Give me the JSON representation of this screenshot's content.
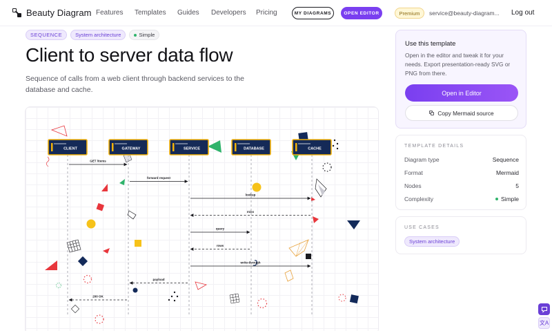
{
  "nav": {
    "brand": "Beauty Diagram",
    "links": [
      "Features",
      "Templates",
      "Guides",
      "Developers",
      "Pricing"
    ],
    "my_diagrams": "MY DIAGRAMS",
    "open_editor": "OPEN EDITOR",
    "premium": "Premium",
    "email": "service@beauty-diagram...",
    "logout": "Log out"
  },
  "hero": {
    "tags": {
      "type": "SEQUENCE",
      "category": "System architecture",
      "complexity": "Simple"
    },
    "title": "Client to server data flow",
    "subtitle": "Sequence of calls from a web client through backend services to the database and cache."
  },
  "diagram": {
    "participants": [
      "CLIENT",
      "GATEWAY",
      "SERVICE",
      "DATABASE",
      "CACHE"
    ],
    "messages": [
      {
        "from": 0,
        "to": 1,
        "label": "GET /items",
        "dashed": false
      },
      {
        "from": 1,
        "to": 2,
        "label": "forward request",
        "dashed": false
      },
      {
        "from": 2,
        "to": 4,
        "label": "lookup",
        "dashed": false
      },
      {
        "from": 4,
        "to": 2,
        "label": "miss",
        "dashed": true
      },
      {
        "from": 2,
        "to": 3,
        "label": "query",
        "dashed": false
      },
      {
        "from": 3,
        "to": 2,
        "label": "rows",
        "dashed": true
      },
      {
        "from": 2,
        "to": 4,
        "label": "write-through",
        "dashed": false
      },
      {
        "from": 2,
        "to": 1,
        "label": "payload",
        "dashed": true
      },
      {
        "from": 1,
        "to": 0,
        "label": "200 OK",
        "dashed": true
      }
    ],
    "colors": {
      "node_fill": "#152a57",
      "node_border": "#f2b10a",
      "accent_red": "#e8363c",
      "accent_green": "#2fb36b",
      "accent_yellow": "#f6c21a",
      "accent_navy": "#132a5a"
    }
  },
  "sidebar": {
    "template": {
      "heading": "Use this template",
      "description": "Open in the editor and tweak it for your needs. Export presentation-ready SVG or PNG from there.",
      "open_button": "Open in Editor",
      "copy_button": "Copy Mermaid source"
    },
    "details": {
      "label": "TEMPLATE DETAILS",
      "rows": [
        {
          "key": "Diagram type",
          "value": "Sequence"
        },
        {
          "key": "Format",
          "value": "Mermaid"
        },
        {
          "key": "Nodes",
          "value": "5"
        },
        {
          "key": "Complexity",
          "value": "Simple"
        }
      ]
    },
    "use_cases": {
      "label": "USE CASES",
      "tags": [
        "System architecture"
      ]
    }
  },
  "floating": {
    "translate_label": "文A"
  }
}
